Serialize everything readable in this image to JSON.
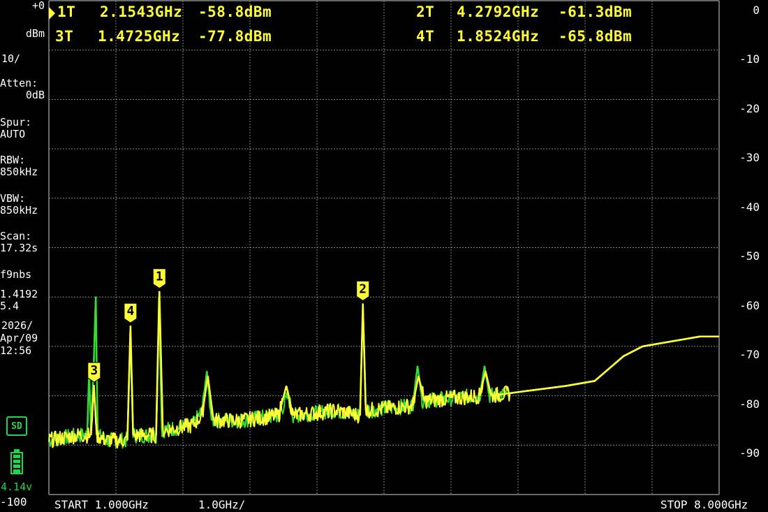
{
  "status": {
    "ref_level": "+0",
    "ref_unit": "dBm",
    "scale": "10/",
    "atten_label": "Atten:",
    "atten_value": "0dB",
    "spur_label": "Spur:",
    "spur_value": "AUTO",
    "rbw_label": "RBW:",
    "rbw_value": "850kHz",
    "vbw_label": "VBW:",
    "vbw_value": "850kHz",
    "scan_label": "Scan:",
    "scan_value": "17.32s",
    "info_label": "f9nbs",
    "info_value": "1.4192",
    "info_value2": "5.4",
    "date_year": "2026/",
    "date_md": "Apr/09",
    "time": "12:56",
    "sd_label": "SD",
    "battery_voltage": "4.14v",
    "bottom_level": "-100"
  },
  "markers_readout": {
    "m1_id": "1T",
    "m1_freq": "2.1543GHz",
    "m1_level": "-58.8dBm",
    "m2_id": "2T",
    "m2_freq": "4.2792GHz",
    "m2_level": "-61.3dBm",
    "m3_id": "3T",
    "m3_freq": "1.4725GHz",
    "m3_level": "-77.8dBm",
    "m4_id": "4T",
    "m4_freq": "1.8524GHz",
    "m4_level": "-65.8dBm"
  },
  "y_scale_labels": [
    "0",
    "-10",
    "-20",
    "-30",
    "-40",
    "-50",
    "-60",
    "-70",
    "-80",
    "-90"
  ],
  "footer": {
    "start": "START 1.000GHz",
    "div": "1.0GHz/",
    "stop": "STOP 8.000GHz"
  },
  "colors": {
    "trace_primary": "#ffff33",
    "trace_secondary": "#33dd33",
    "grid": "#8a8a8a",
    "battery": "#1ed64a"
  },
  "chart_data": {
    "type": "line",
    "x_range_ghz": [
      1.0,
      8.0
    ],
    "y_range_dbm": [
      -100,
      0
    ],
    "grid": true,
    "markers": [
      {
        "label": "1",
        "freq_ghz": 2.1543,
        "level_dbm": -58.8
      },
      {
        "label": "2",
        "freq_ghz": 4.2792,
        "level_dbm": -61.3
      },
      {
        "label": "3",
        "freq_ghz": 1.4725,
        "level_dbm": -77.8
      },
      {
        "label": "4",
        "freq_ghz": 1.8524,
        "level_dbm": -65.8
      }
    ],
    "series": [
      {
        "color": "#33dd33",
        "points": [
          [
            1.0,
            -89
          ],
          [
            1.3,
            -88
          ],
          [
            1.4,
            -88
          ],
          [
            1.42,
            -75
          ],
          [
            1.44,
            -87
          ],
          [
            1.47,
            -73
          ],
          [
            1.49,
            -60
          ],
          [
            1.51,
            -88
          ],
          [
            1.6,
            -89
          ],
          [
            1.82,
            -89
          ],
          [
            1.85,
            -67
          ],
          [
            1.88,
            -88
          ],
          [
            2.12,
            -88
          ],
          [
            2.15,
            -60
          ],
          [
            2.18,
            -87
          ],
          [
            2.5,
            -86
          ],
          [
            2.6,
            -83
          ],
          [
            2.65,
            -75
          ],
          [
            2.7,
            -85
          ],
          [
            3.0,
            -85
          ],
          [
            3.4,
            -84
          ],
          [
            3.5,
            -80
          ],
          [
            3.55,
            -84
          ],
          [
            4.0,
            -83
          ],
          [
            4.25,
            -84
          ],
          [
            4.28,
            -62
          ],
          [
            4.31,
            -83
          ],
          [
            4.8,
            -82
          ],
          [
            4.85,
            -74
          ],
          [
            4.9,
            -81
          ],
          [
            5.5,
            -80
          ],
          [
            5.55,
            -74
          ],
          [
            5.6,
            -80
          ],
          [
            6.0,
            -79
          ],
          [
            6.4,
            -78
          ],
          [
            6.7,
            -77
          ],
          [
            7.0,
            -72
          ],
          [
            7.2,
            -70
          ],
          [
            7.5,
            -69
          ],
          [
            7.8,
            -68
          ],
          [
            8.0,
            -68
          ]
        ]
      },
      {
        "color": "#ffff33",
        "points": [
          [
            1.0,
            -89
          ],
          [
            1.3,
            -88
          ],
          [
            1.44,
            -88
          ],
          [
            1.47,
            -77.8
          ],
          [
            1.5,
            -88
          ],
          [
            1.6,
            -89
          ],
          [
            1.82,
            -89
          ],
          [
            1.8524,
            -65.8
          ],
          [
            1.88,
            -88
          ],
          [
            2.12,
            -88
          ],
          [
            2.1543,
            -58.8
          ],
          [
            2.19,
            -87
          ],
          [
            2.5,
            -86
          ],
          [
            2.6,
            -84
          ],
          [
            2.66,
            -76
          ],
          [
            2.72,
            -85
          ],
          [
            3.0,
            -85
          ],
          [
            3.4,
            -84
          ],
          [
            3.48,
            -78
          ],
          [
            3.55,
            -84
          ],
          [
            4.0,
            -83
          ],
          [
            4.25,
            -84
          ],
          [
            4.2792,
            -61.3
          ],
          [
            4.31,
            -83
          ],
          [
            4.8,
            -82
          ],
          [
            4.86,
            -76
          ],
          [
            4.92,
            -81
          ],
          [
            5.5,
            -80
          ],
          [
            5.56,
            -75
          ],
          [
            5.62,
            -80
          ],
          [
            6.0,
            -79
          ],
          [
            6.4,
            -78
          ],
          [
            6.7,
            -77
          ],
          [
            7.0,
            -72
          ],
          [
            7.2,
            -70
          ],
          [
            7.5,
            -69
          ],
          [
            7.8,
            -68
          ],
          [
            8.0,
            -68
          ]
        ]
      }
    ]
  }
}
